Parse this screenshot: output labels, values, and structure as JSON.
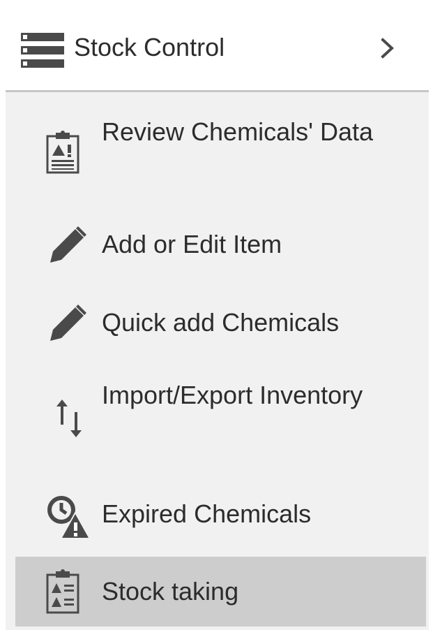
{
  "header": {
    "title": "Stock Control",
    "menu_icon": "list-rows-icon",
    "chevron_icon": "chevron-right-icon"
  },
  "menu": {
    "items": [
      {
        "label": "Review Chemicals' Data",
        "icon": "clipboard-warning-icon",
        "active": false
      },
      {
        "label": "Add or Edit Item",
        "icon": "pencil-icon",
        "active": false
      },
      {
        "label": "Quick add Chemicals",
        "icon": "pencil-icon",
        "active": false
      },
      {
        "label": "Import/Export Inventory",
        "icon": "import-export-arrows-icon",
        "active": false
      },
      {
        "label": "Expired Chemicals",
        "icon": "clock-warning-icon",
        "active": false
      },
      {
        "label": "Stock taking",
        "icon": "clipboard-checklist-icon",
        "active": true
      }
    ]
  },
  "colors": {
    "text": "#2c2c2c",
    "icon": "#4a4a4a",
    "menu_background": "#f1f1f1",
    "active_background": "#cdcdcd",
    "header_background": "#ffffff",
    "divider": "#c6c6c6"
  }
}
